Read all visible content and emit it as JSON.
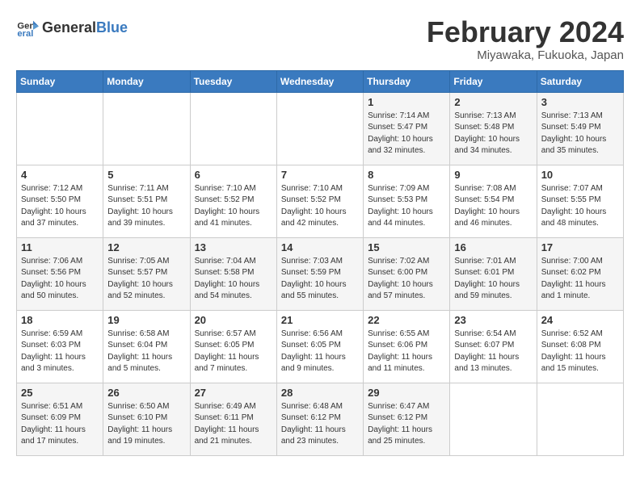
{
  "header": {
    "logo_general": "General",
    "logo_blue": "Blue",
    "month_title": "February 2024",
    "location": "Miyawaka, Fukuoka, Japan"
  },
  "weekdays": [
    "Sunday",
    "Monday",
    "Tuesday",
    "Wednesday",
    "Thursday",
    "Friday",
    "Saturday"
  ],
  "weeks": [
    [
      {
        "day": "",
        "sunrise": "",
        "sunset": "",
        "daylight": ""
      },
      {
        "day": "",
        "sunrise": "",
        "sunset": "",
        "daylight": ""
      },
      {
        "day": "",
        "sunrise": "",
        "sunset": "",
        "daylight": ""
      },
      {
        "day": "",
        "sunrise": "",
        "sunset": "",
        "daylight": ""
      },
      {
        "day": "1",
        "sunrise": "Sunrise: 7:14 AM",
        "sunset": "Sunset: 5:47 PM",
        "daylight": "Daylight: 10 hours and 32 minutes."
      },
      {
        "day": "2",
        "sunrise": "Sunrise: 7:13 AM",
        "sunset": "Sunset: 5:48 PM",
        "daylight": "Daylight: 10 hours and 34 minutes."
      },
      {
        "day": "3",
        "sunrise": "Sunrise: 7:13 AM",
        "sunset": "Sunset: 5:49 PM",
        "daylight": "Daylight: 10 hours and 35 minutes."
      }
    ],
    [
      {
        "day": "4",
        "sunrise": "Sunrise: 7:12 AM",
        "sunset": "Sunset: 5:50 PM",
        "daylight": "Daylight: 10 hours and 37 minutes."
      },
      {
        "day": "5",
        "sunrise": "Sunrise: 7:11 AM",
        "sunset": "Sunset: 5:51 PM",
        "daylight": "Daylight: 10 hours and 39 minutes."
      },
      {
        "day": "6",
        "sunrise": "Sunrise: 7:10 AM",
        "sunset": "Sunset: 5:52 PM",
        "daylight": "Daylight: 10 hours and 41 minutes."
      },
      {
        "day": "7",
        "sunrise": "Sunrise: 7:10 AM",
        "sunset": "Sunset: 5:52 PM",
        "daylight": "Daylight: 10 hours and 42 minutes."
      },
      {
        "day": "8",
        "sunrise": "Sunrise: 7:09 AM",
        "sunset": "Sunset: 5:53 PM",
        "daylight": "Daylight: 10 hours and 44 minutes."
      },
      {
        "day": "9",
        "sunrise": "Sunrise: 7:08 AM",
        "sunset": "Sunset: 5:54 PM",
        "daylight": "Daylight: 10 hours and 46 minutes."
      },
      {
        "day": "10",
        "sunrise": "Sunrise: 7:07 AM",
        "sunset": "Sunset: 5:55 PM",
        "daylight": "Daylight: 10 hours and 48 minutes."
      }
    ],
    [
      {
        "day": "11",
        "sunrise": "Sunrise: 7:06 AM",
        "sunset": "Sunset: 5:56 PM",
        "daylight": "Daylight: 10 hours and 50 minutes."
      },
      {
        "day": "12",
        "sunrise": "Sunrise: 7:05 AM",
        "sunset": "Sunset: 5:57 PM",
        "daylight": "Daylight: 10 hours and 52 minutes."
      },
      {
        "day": "13",
        "sunrise": "Sunrise: 7:04 AM",
        "sunset": "Sunset: 5:58 PM",
        "daylight": "Daylight: 10 hours and 54 minutes."
      },
      {
        "day": "14",
        "sunrise": "Sunrise: 7:03 AM",
        "sunset": "Sunset: 5:59 PM",
        "daylight": "Daylight: 10 hours and 55 minutes."
      },
      {
        "day": "15",
        "sunrise": "Sunrise: 7:02 AM",
        "sunset": "Sunset: 6:00 PM",
        "daylight": "Daylight: 10 hours and 57 minutes."
      },
      {
        "day": "16",
        "sunrise": "Sunrise: 7:01 AM",
        "sunset": "Sunset: 6:01 PM",
        "daylight": "Daylight: 10 hours and 59 minutes."
      },
      {
        "day": "17",
        "sunrise": "Sunrise: 7:00 AM",
        "sunset": "Sunset: 6:02 PM",
        "daylight": "Daylight: 11 hours and 1 minute."
      }
    ],
    [
      {
        "day": "18",
        "sunrise": "Sunrise: 6:59 AM",
        "sunset": "Sunset: 6:03 PM",
        "daylight": "Daylight: 11 hours and 3 minutes."
      },
      {
        "day": "19",
        "sunrise": "Sunrise: 6:58 AM",
        "sunset": "Sunset: 6:04 PM",
        "daylight": "Daylight: 11 hours and 5 minutes."
      },
      {
        "day": "20",
        "sunrise": "Sunrise: 6:57 AM",
        "sunset": "Sunset: 6:05 PM",
        "daylight": "Daylight: 11 hours and 7 minutes."
      },
      {
        "day": "21",
        "sunrise": "Sunrise: 6:56 AM",
        "sunset": "Sunset: 6:05 PM",
        "daylight": "Daylight: 11 hours and 9 minutes."
      },
      {
        "day": "22",
        "sunrise": "Sunrise: 6:55 AM",
        "sunset": "Sunset: 6:06 PM",
        "daylight": "Daylight: 11 hours and 11 minutes."
      },
      {
        "day": "23",
        "sunrise": "Sunrise: 6:54 AM",
        "sunset": "Sunset: 6:07 PM",
        "daylight": "Daylight: 11 hours and 13 minutes."
      },
      {
        "day": "24",
        "sunrise": "Sunrise: 6:52 AM",
        "sunset": "Sunset: 6:08 PM",
        "daylight": "Daylight: 11 hours and 15 minutes."
      }
    ],
    [
      {
        "day": "25",
        "sunrise": "Sunrise: 6:51 AM",
        "sunset": "Sunset: 6:09 PM",
        "daylight": "Daylight: 11 hours and 17 minutes."
      },
      {
        "day": "26",
        "sunrise": "Sunrise: 6:50 AM",
        "sunset": "Sunset: 6:10 PM",
        "daylight": "Daylight: 11 hours and 19 minutes."
      },
      {
        "day": "27",
        "sunrise": "Sunrise: 6:49 AM",
        "sunset": "Sunset: 6:11 PM",
        "daylight": "Daylight: 11 hours and 21 minutes."
      },
      {
        "day": "28",
        "sunrise": "Sunrise: 6:48 AM",
        "sunset": "Sunset: 6:12 PM",
        "daylight": "Daylight: 11 hours and 23 minutes."
      },
      {
        "day": "29",
        "sunrise": "Sunrise: 6:47 AM",
        "sunset": "Sunset: 6:12 PM",
        "daylight": "Daylight: 11 hours and 25 minutes."
      },
      {
        "day": "",
        "sunrise": "",
        "sunset": "",
        "daylight": ""
      },
      {
        "day": "",
        "sunrise": "",
        "sunset": "",
        "daylight": ""
      }
    ]
  ]
}
